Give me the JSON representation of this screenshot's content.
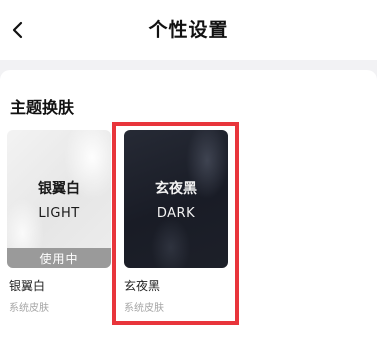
{
  "header": {
    "title": "个性设置",
    "back_icon": "chevron-left-icon"
  },
  "section": {
    "title": "主题换肤"
  },
  "themes": [
    {
      "name": "银翼白",
      "subtitle": "LIGHT",
      "label": "银翼白",
      "type": "系统皮肤",
      "badge": "使用中",
      "in_use": true,
      "style": "light"
    },
    {
      "name": "玄夜黑",
      "subtitle": "DARK",
      "label": "玄夜黑",
      "type": "系统皮肤",
      "in_use": false,
      "style": "dark",
      "highlighted": true
    }
  ],
  "colors": {
    "highlight": "#e8353b",
    "badge_bg": "#9a9a9a"
  }
}
